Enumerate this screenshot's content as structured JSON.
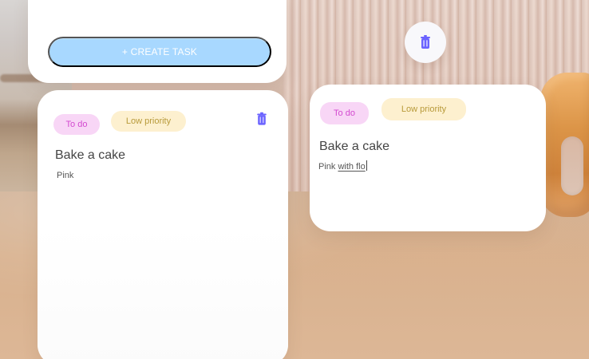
{
  "top_panel": {
    "create_task_label": "+ CREATE TASK"
  },
  "cards": [
    {
      "status": "To do",
      "priority": "Low priority",
      "title": "Bake a cake",
      "description": "Pink"
    },
    {
      "status": "To do",
      "priority": "Low priority",
      "title": "Bake a cake",
      "description_plain": "Pink ",
      "description_editing": "with flo"
    }
  ],
  "icons": {
    "trash": "trash-icon",
    "drop_target": "trash-icon"
  },
  "colors": {
    "create_button": "#a8d8ff",
    "todo_chip_bg": "#f8d6f6",
    "todo_chip_text": "#d34ad0",
    "low_priority_bg": "#fdf0cf",
    "low_priority_text": "#b89a3a",
    "trash_icon": "#6b63ff",
    "card_bg": "#ffffff"
  }
}
